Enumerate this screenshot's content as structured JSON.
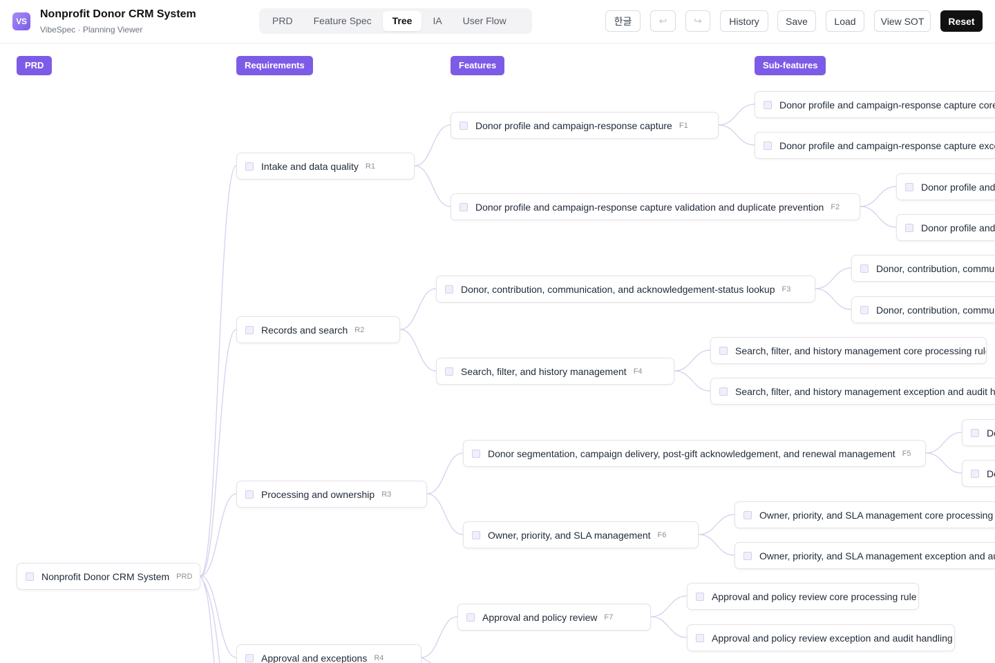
{
  "app": {
    "logo_text": "VS",
    "title": "Nonprofit Donor CRM System",
    "subtitle": "VibeSpec · Planning Viewer"
  },
  "tabs": [
    {
      "label": "PRD",
      "active": false
    },
    {
      "label": "Feature Spec",
      "active": false
    },
    {
      "label": "Tree",
      "active": true
    },
    {
      "label": "IA",
      "active": false
    },
    {
      "label": "User Flow",
      "active": false
    }
  ],
  "toolbar": {
    "language": "한글",
    "undo_glyph": "↩",
    "redo_glyph": "↪",
    "history": "History",
    "save": "Save",
    "load": "Load",
    "view_sot": "View SOT",
    "reset": "Reset"
  },
  "columns": {
    "prd": "PRD",
    "requirements": "Requirements",
    "features": "Features",
    "subfeatures": "Sub-features"
  },
  "tree": {
    "root": {
      "label": "Nonprofit Donor CRM System",
      "tag": "PRD"
    },
    "requirements": [
      {
        "label": "Intake and data quality",
        "tag": "R1"
      },
      {
        "label": "Records and search",
        "tag": "R2"
      },
      {
        "label": "Processing and ownership",
        "tag": "R3"
      },
      {
        "label": "Approval and exceptions",
        "tag": "R4"
      }
    ],
    "features": [
      {
        "label": "Donor profile and campaign-response capture",
        "tag": "F1"
      },
      {
        "label": "Donor profile and campaign-response capture validation and duplicate prevention",
        "tag": "F2"
      },
      {
        "label": "Donor, contribution, communication, and acknowledgement-status lookup",
        "tag": "F3"
      },
      {
        "label": "Search, filter, and history management",
        "tag": "F4"
      },
      {
        "label": "Donor segmentation, campaign delivery, post-gift acknowledgement, and renewal management",
        "tag": "F5"
      },
      {
        "label": "Owner, priority, and SLA management",
        "tag": "F6"
      },
      {
        "label": "Approval and policy review",
        "tag": "F7"
      }
    ],
    "subfeatures": [
      {
        "label": "Donor profile and campaign-response capture core pro"
      },
      {
        "label": "Donor profile and campaign-response capture exceptio"
      },
      {
        "label": "Donor profile and c"
      },
      {
        "label": "Donor profile and c"
      },
      {
        "label": "Donor, contribution, communic"
      },
      {
        "label": "Donor, contribution, communic"
      },
      {
        "label": "Search, filter, and history management core processing rule"
      },
      {
        "label": "Search, filter, and history management exception and audit handlin"
      },
      {
        "label": "Do"
      },
      {
        "label": "Do"
      },
      {
        "label": "Owner, priority, and SLA management core processing rule"
      },
      {
        "label": "Owner, priority, and SLA management exception and audit h"
      },
      {
        "label": "Approval and policy review core processing rule"
      },
      {
        "label": "Approval and policy review exception and audit handling"
      }
    ]
  }
}
